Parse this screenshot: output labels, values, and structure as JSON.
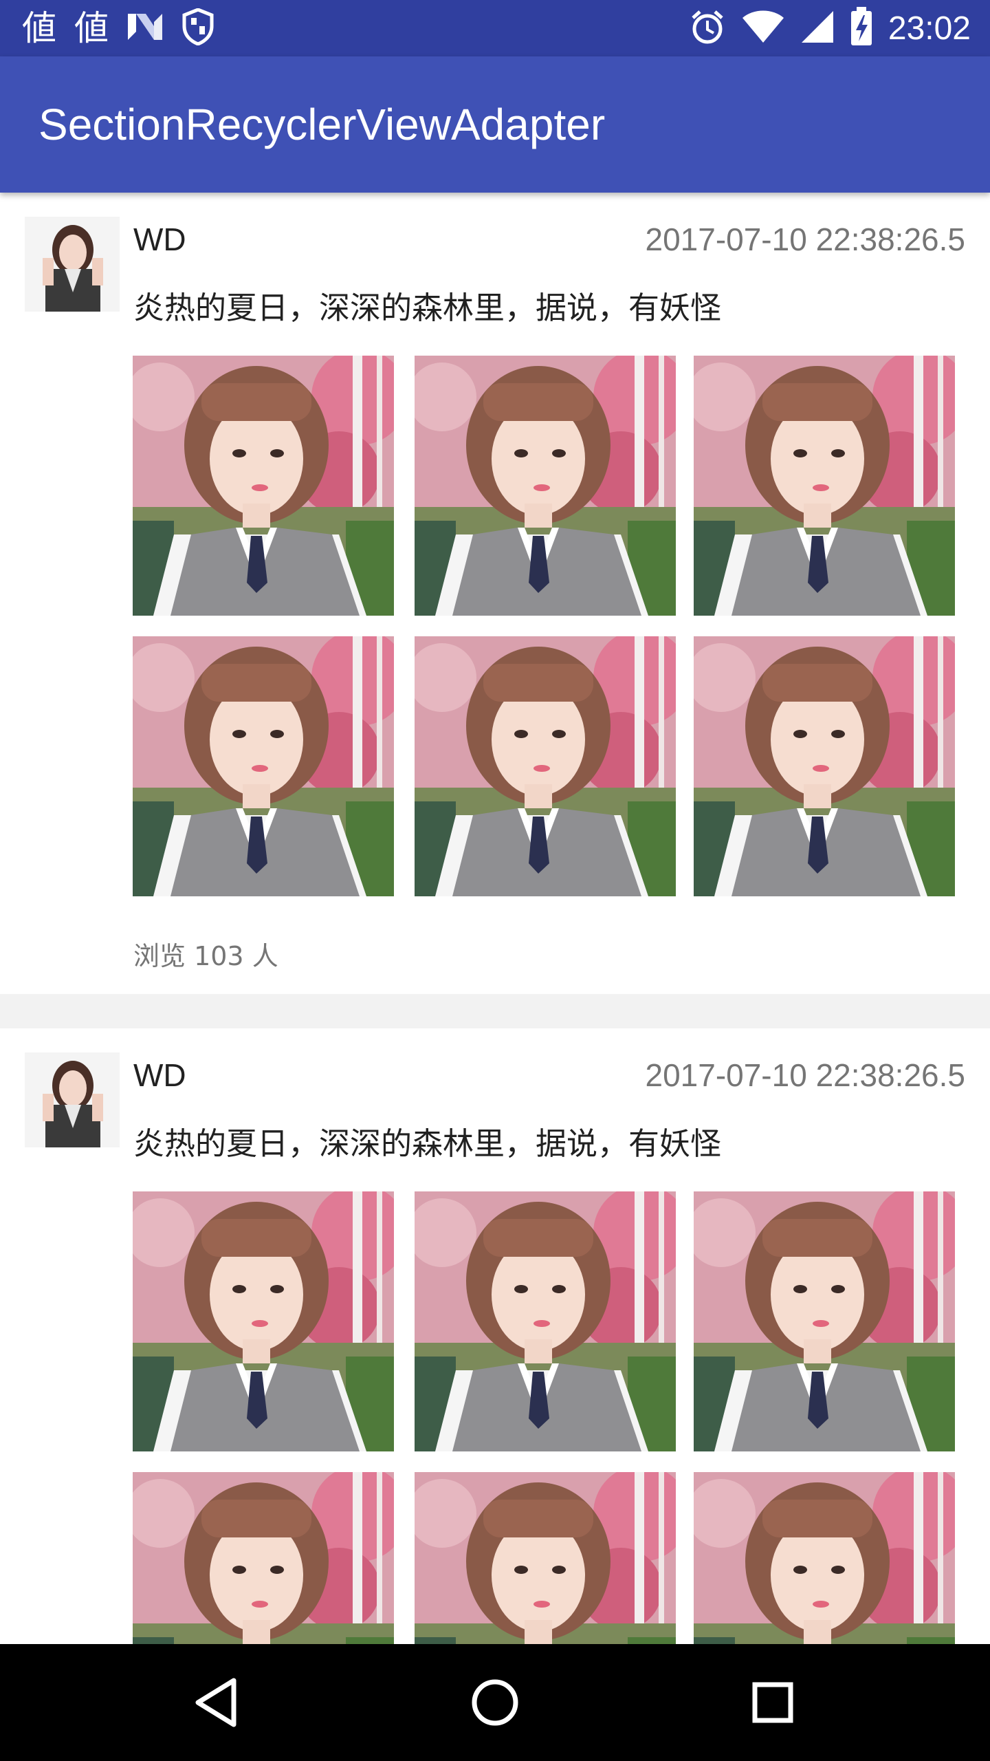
{
  "status_bar": {
    "left_glyphs": [
      "値",
      "値"
    ],
    "left_icons": [
      "n-logo-icon",
      "shield-icon"
    ],
    "right_icons": [
      "alarm-icon",
      "wifi-icon",
      "signal-icon",
      "battery-charging-icon"
    ],
    "time": "23:02"
  },
  "app_bar": {
    "title": "SectionRecyclerViewAdapter"
  },
  "feed": {
    "posts": [
      {
        "author": "WD",
        "timestamp": "2017-07-10 22:38:26.5",
        "text": "炎热的夏日，深深的森林里，据说，有妖怪",
        "views": "浏览 103 人",
        "photo_count": 6
      },
      {
        "author": "WD",
        "timestamp": "2017-07-10 22:38:26.5",
        "text": "炎热的夏日，深深的森林里，据说，有妖怪",
        "photo_count": 6
      }
    ]
  },
  "nav_bar": {
    "buttons": [
      "back-icon",
      "home-icon",
      "recents-icon"
    ]
  },
  "colors": {
    "status_bar": "#303F9F",
    "app_bar": "#3F51B5",
    "primary_text": "#212121",
    "secondary_text": "#757575",
    "divider": "#F2F2F2"
  }
}
